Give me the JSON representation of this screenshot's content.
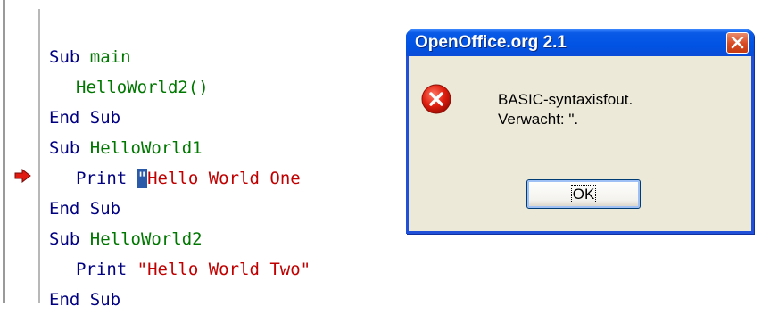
{
  "editor": {
    "lines": [
      {
        "kw": "Sub",
        "id": "main"
      },
      {
        "call": "HelloWorld2()"
      },
      {
        "kw": "End Sub"
      },
      {
        "kw": "Sub",
        "id": "HelloWorld1"
      },
      {
        "kw": "Print",
        "caret": "\"",
        "str": "Hello World One"
      },
      {
        "kw": "End Sub"
      },
      {
        "kw": "Sub",
        "id": "HelloWorld2"
      },
      {
        "kw": "Print",
        "str": "\"Hello World Two\""
      },
      {
        "kw": "End Sub"
      }
    ],
    "error_marker_icon": "red-arrow-icon"
  },
  "dialog": {
    "title": "OpenOffice.org 2.1",
    "message_line1": "BASIC-syntaxisfout.",
    "message_line2": "Verwacht: \".",
    "ok_label": "OK",
    "icon": "error-icon",
    "close_icon": "close-icon"
  },
  "colors": {
    "keyword": "#000080",
    "identifier": "#007700",
    "string": "#c00000",
    "titlebar": "#0153e4",
    "dialog_bg": "#ece9d8"
  }
}
